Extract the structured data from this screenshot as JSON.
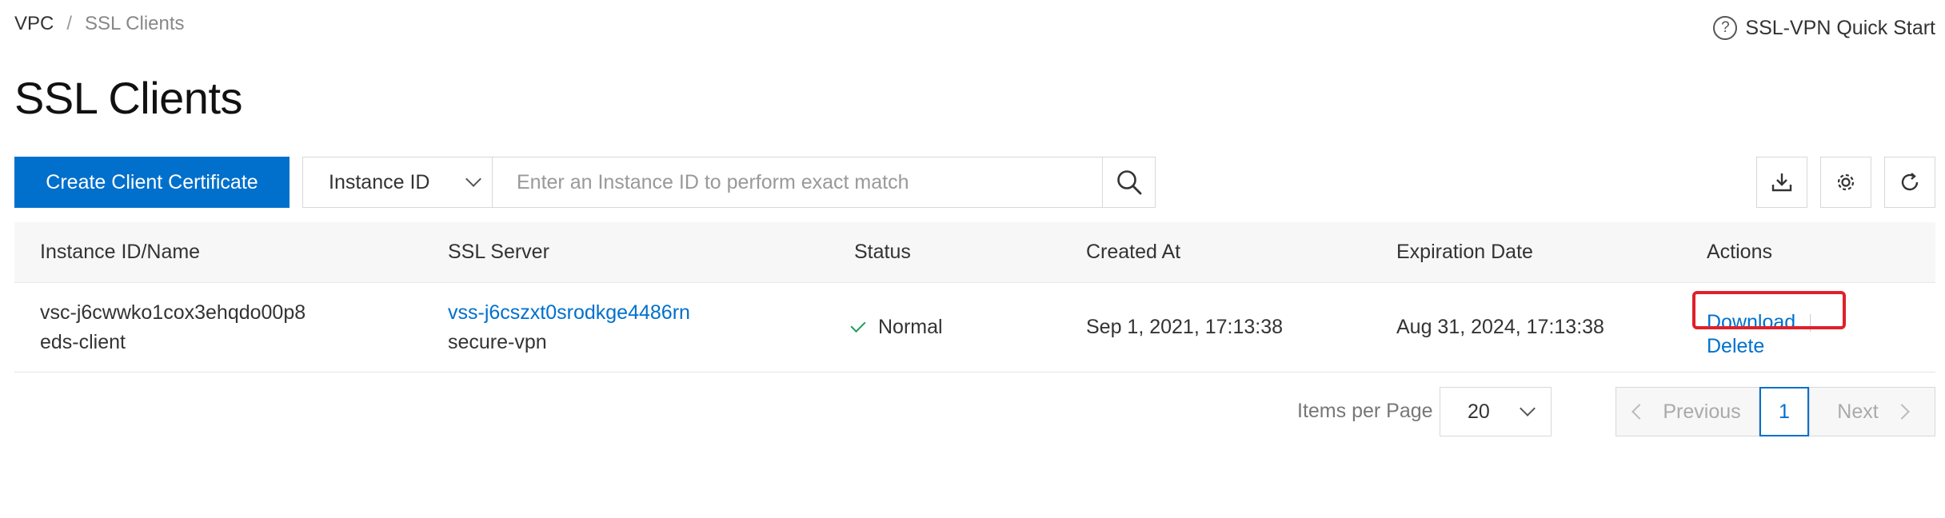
{
  "breadcrumb": {
    "root": "VPC",
    "separator": "/",
    "current": "SSL Clients"
  },
  "help": {
    "label": "SSL-VPN Quick Start",
    "icon": "question-circle-icon"
  },
  "page": {
    "title": "SSL Clients"
  },
  "toolbar": {
    "create_label": "Create Client Certificate",
    "filter_select": "Instance ID",
    "search_placeholder": "Enter an Instance ID to perform exact match",
    "icons": [
      "search-icon",
      "download-icon",
      "gear-icon",
      "refresh-icon"
    ]
  },
  "table": {
    "columns": [
      "Instance ID/Name",
      "SSL Server",
      "Status",
      "Created At",
      "Expiration Date",
      "Actions"
    ],
    "rows": [
      {
        "instance_id": "vsc-j6cwwko1cox3ehqdo00p8",
        "instance_name": "eds-client",
        "server_id": "vss-j6cszxt0srodkge4486rn",
        "server_name": "secure-vpn",
        "status": "Normal",
        "created_at": "Sep 1, 2021, 17:13:38",
        "expiration": "Aug 31, 2024, 17:13:38",
        "actions": [
          "Download",
          "Delete"
        ]
      }
    ]
  },
  "pagination": {
    "items_per_page_label": "Items per Page",
    "items_per_page": "20",
    "previous": "Previous",
    "current_page": "1",
    "next": "Next"
  },
  "colors": {
    "primary": "#0070cc",
    "highlight": "#e0202a",
    "status_ok": "#1e9e5a"
  }
}
